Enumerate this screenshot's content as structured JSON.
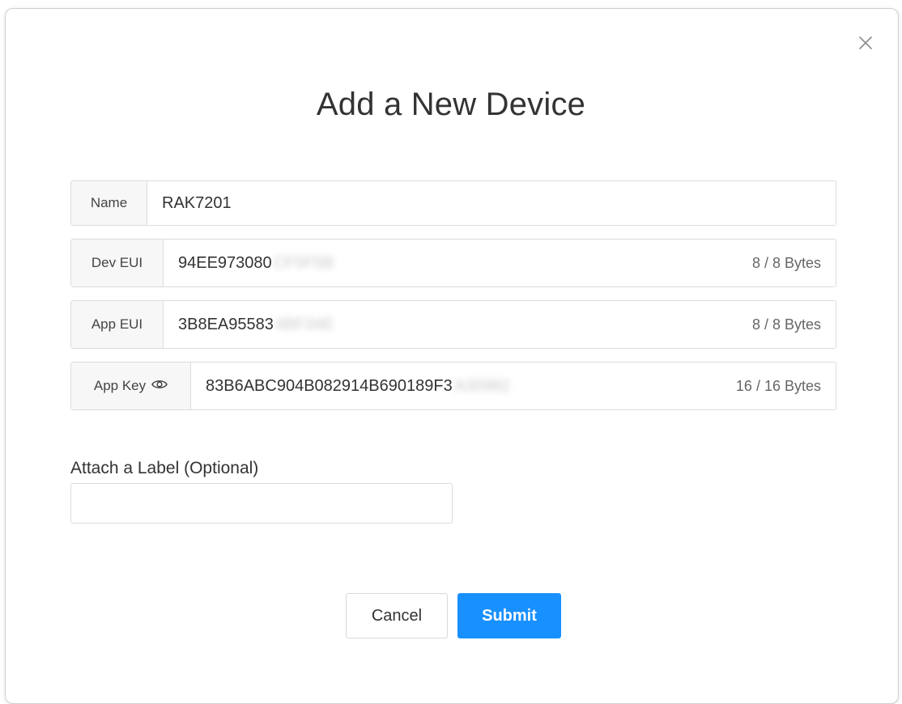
{
  "modal": {
    "title": "Add a New Device",
    "close_icon": "close-icon"
  },
  "fields": {
    "name": {
      "label": "Name",
      "value": "RAK7201"
    },
    "dev_eui": {
      "label": "Dev EUI",
      "value": "94EE973080",
      "masked": "CF5F5B",
      "bytes": "8 / 8 Bytes"
    },
    "app_eui": {
      "label": "App EUI",
      "value": "3B8EA95583",
      "masked": "4BF34E",
      "bytes": "8 / 8 Bytes"
    },
    "app_key": {
      "label": "App Key",
      "icon": "eye-icon",
      "value": "83B6ABC904B082914B690189F3",
      "masked": "A30982",
      "bytes": "16 / 16 Bytes"
    }
  },
  "label_section": {
    "heading": "Attach a Label (Optional)",
    "value": ""
  },
  "buttons": {
    "cancel": "Cancel",
    "submit": "Submit"
  },
  "colors": {
    "primary": "#1890ff",
    "border": "#dcdcdc",
    "addon_bg": "#f7f7f7"
  }
}
